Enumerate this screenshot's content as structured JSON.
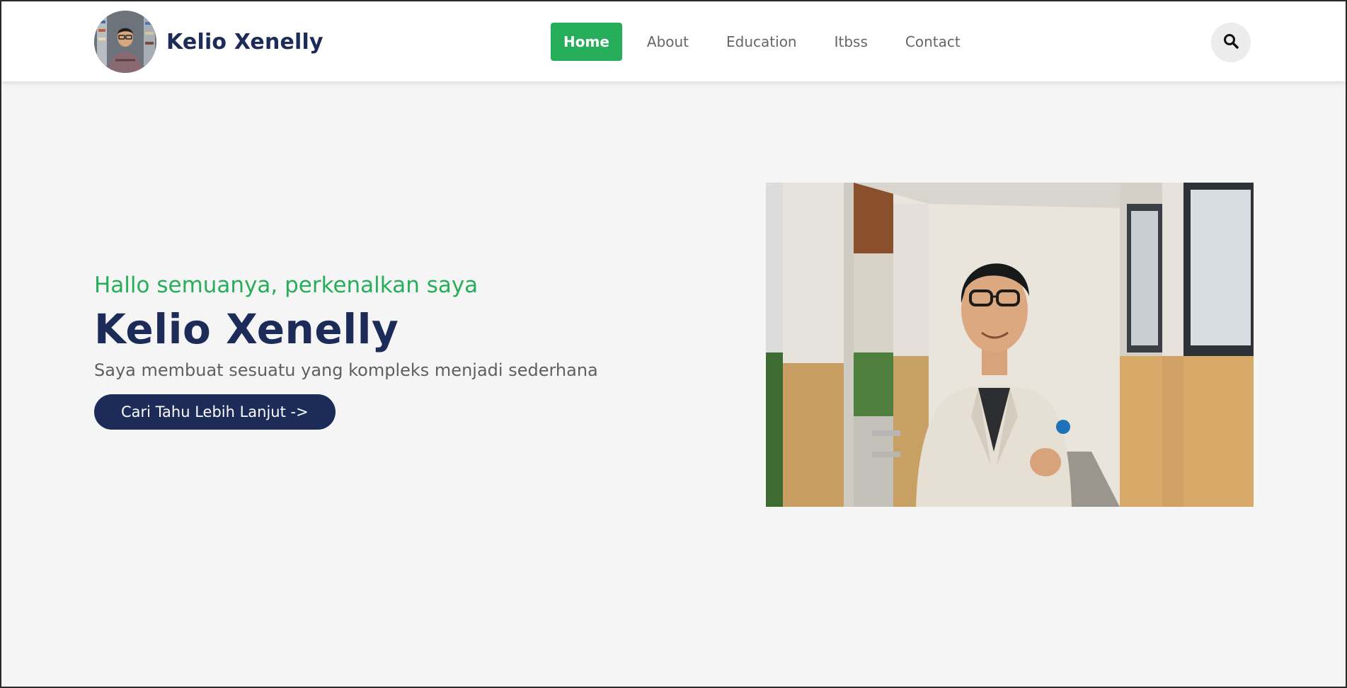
{
  "header": {
    "brand_name": "Kelio Xenelly",
    "nav": [
      {
        "label": "Home",
        "active": true
      },
      {
        "label": "About",
        "active": false
      },
      {
        "label": "Education",
        "active": false
      },
      {
        "label": "Itbss",
        "active": false
      },
      {
        "label": "Contact",
        "active": false
      }
    ],
    "search_icon": "search-icon"
  },
  "hero": {
    "greeting": "Hallo semuanya, perkenalkan saya",
    "name": "Kelio Xenelly",
    "tagline": "Saya membuat sesuatu yang kompleks menjadi sederhana",
    "cta_label": "Cari Tahu Lebih Lanjut ->"
  },
  "colors": {
    "accent_green": "#27ae5a",
    "navy": "#1c2b58",
    "background": "#f5f5f5",
    "text_gray": "#5f5f5f"
  }
}
